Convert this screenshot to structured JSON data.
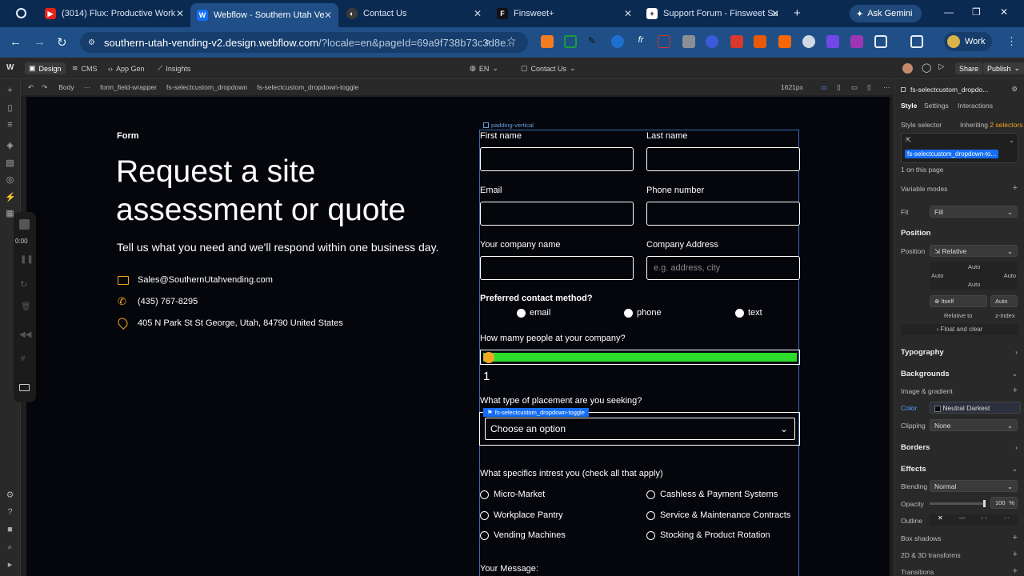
{
  "browser": {
    "tabs": [
      {
        "label": "(3014) Flux: Productive Work",
        "favicon": "youtube-icon"
      },
      {
        "label": "Webflow - Southern Utah Ve",
        "favicon": "webflow-icon",
        "active": true
      },
      {
        "label": "Contact Us",
        "favicon": "globe-icon"
      },
      {
        "label": "Finsweet+",
        "favicon": "finsweet-icon"
      },
      {
        "label": "Support Forum - Finsweet Su",
        "favicon": "support-icon"
      }
    ],
    "ask_gemini": "Ask Gemini",
    "url_host": "southern-utah-vending-v2.design.webflow.com",
    "url_rest": "/?locale=en&pageId=69a9f738b73c3d8e...",
    "profile_label": "Work"
  },
  "webflow_top": {
    "design": "Design",
    "cms": "CMS",
    "app_gen": "App Gen",
    "insights": "Insights",
    "locale": "EN",
    "page": "Contact Us",
    "share": "Share",
    "publish": "Publish",
    "width_readout": "1621px"
  },
  "breadcrumb": [
    "Body",
    "···",
    "form_field-wrapper",
    "fs-selectcustom_dropdown",
    "fs-selectcustom_dropdown-toggle"
  ],
  "float_panel": {
    "timer": "0:00"
  },
  "page": {
    "eyebrow": "Form",
    "headline_line1": "Request a site",
    "headline_line2": "assessment or quote",
    "subhead": "Tell us what you need and we'll respond within one business day.",
    "email": "Sales@SouthernUtahvending.com",
    "phone": "(435) 767-8295",
    "address": "405 N Park St St George, Utah, 84790 United States",
    "padding_tag": "padding-vertical",
    "form": {
      "first_name": "First name",
      "last_name": "Last name",
      "email_label": "Email",
      "phone_label": "Phone number",
      "company_label": "Your company name",
      "company_address_label": "Company Address",
      "company_address_placeholder": "e.g. address, city",
      "contact_method_label": "Preferred contact method?",
      "contact_options": [
        "email",
        "phone",
        "text"
      ],
      "people_label": "How mamy people at your company?",
      "slider_value": "1",
      "placement_label": "What type of placement are you seeking?",
      "dropdown_tag": "fs-selectcustom_dropdown-toggle",
      "dropdown_value": "Choose an option",
      "specifics_label": "What specifics intrest you (check all that apply)",
      "specifics": [
        "Micro-Market",
        "Cashless & Payment Systems",
        "Workplace Pantry",
        "Service & Maintenance Contracts",
        "Vending Machines",
        "Stocking & Product Rotation"
      ],
      "message_label": "Your Message:"
    }
  },
  "right_panel": {
    "element": "fs-selectcustom_dropdo...",
    "tabs": [
      "Style",
      "Settings",
      "Interactions"
    ],
    "style_selector": "Style selector",
    "inheriting": "Inheriting",
    "inheriting_count": "2 selectors",
    "selector_chip": "fs-selectcustom_dropdown-to...",
    "on_page": "1 on this page",
    "variable_modes": "Variable modes",
    "fit_label": "Fit",
    "fit_value": "Fill",
    "position_h": "Position",
    "position_label": "Position",
    "position_value": "Relative",
    "auto": "Auto",
    "itself": "Itself",
    "relative_to": "Relative to",
    "z_index": "z-Index",
    "float_clear": "Float and clear",
    "typography": "Typography",
    "backgrounds": "Backgrounds",
    "image_gradient": "Image & gradient",
    "color_label": "Color",
    "color_value": "Neutral Darkest",
    "clipping_label": "Clipping",
    "clipping_value": "None",
    "borders": "Borders",
    "effects": "Effects",
    "blending_label": "Blending",
    "blending_value": "Normal",
    "opacity_label": "Opacity",
    "opacity_value": "100",
    "opacity_unit": "%",
    "outline_label": "Outline",
    "box_shadows": "Box shadows",
    "transforms": "2D & 3D transforms",
    "transitions": "Transitions"
  },
  "colors": {
    "accent_orange": "#f5a623",
    "slider_green": "#2bdc2b",
    "webflow_blue": "#146ef5"
  }
}
